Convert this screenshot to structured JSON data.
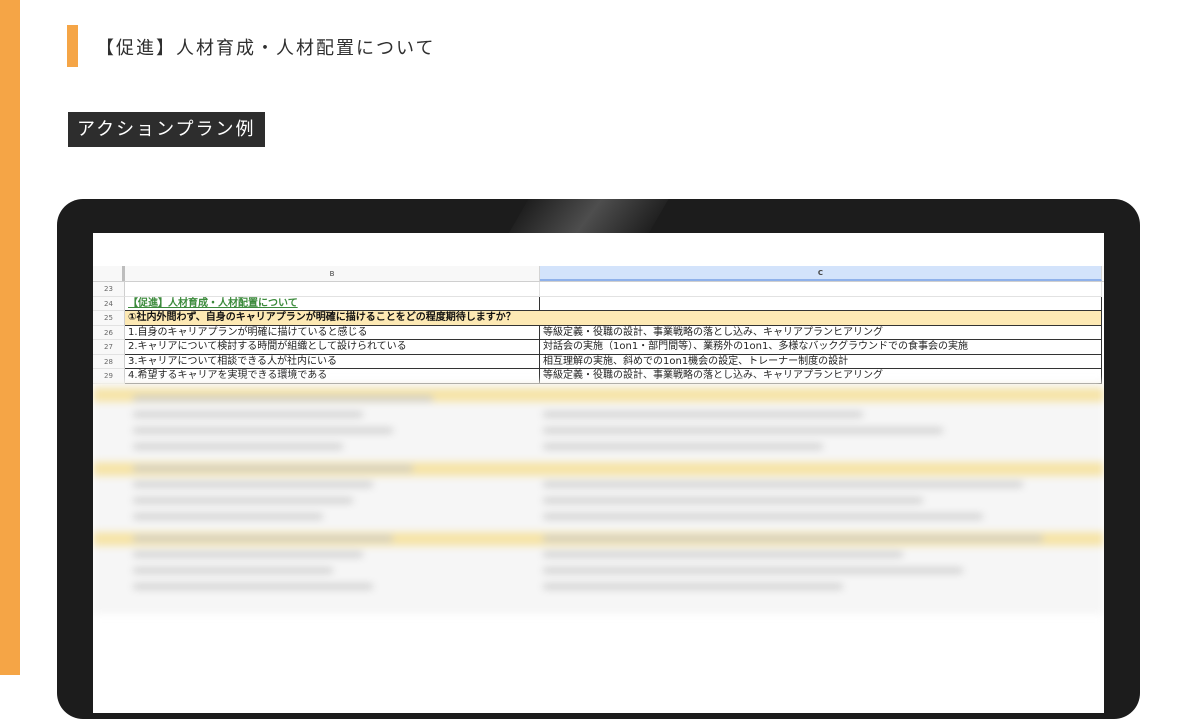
{
  "slide": {
    "title": "【促進】人材育成・人材配置について",
    "section_label": "アクションプラン例"
  },
  "colors": {
    "accent": "#f5a546",
    "label_background": "#2d2d2d",
    "device_frame": "#1c1c1c",
    "question_row": "#fde9b4",
    "category_text": "#3b8a3b",
    "selected_column": "#d3e3fb"
  },
  "spreadsheet": {
    "columns": [
      "B",
      "C"
    ],
    "rows": [
      {
        "num": "23",
        "b": "",
        "c": ""
      },
      {
        "num": "24",
        "b": "【促進】人材育成・人材配置について",
        "c": ""
      },
      {
        "num": "25",
        "b": "①社内外問わず、自身のキャリアプランが明確に描けることをどの程度期待しますか？",
        "c": ""
      },
      {
        "num": "26",
        "b": "1.自身のキャリアプランが明確に描けていると感じる",
        "c": "等級定義・役職の設計、事業戦略の落とし込み、キャリアプランヒアリング"
      },
      {
        "num": "27",
        "b": "2.キャリアについて検討する時間が組織として設けられている",
        "c": "対話会の実施（1on1・部門間等）、業務外の1on1、多様なバックグラウンドでの食事会の実施"
      },
      {
        "num": "28",
        "b": "3.キャリアについて相談できる人が社内にいる",
        "c": "相互理解の実施、斜めでの1on1機会の設定、トレーナー制度の設計"
      },
      {
        "num": "29",
        "b": "4.希望するキャリアを実現できる環境である",
        "c": "等級定義・役職の設計、事業戦略の落とし込み、キャリアプランヒアリング"
      }
    ],
    "blurred_region": "obscured"
  }
}
